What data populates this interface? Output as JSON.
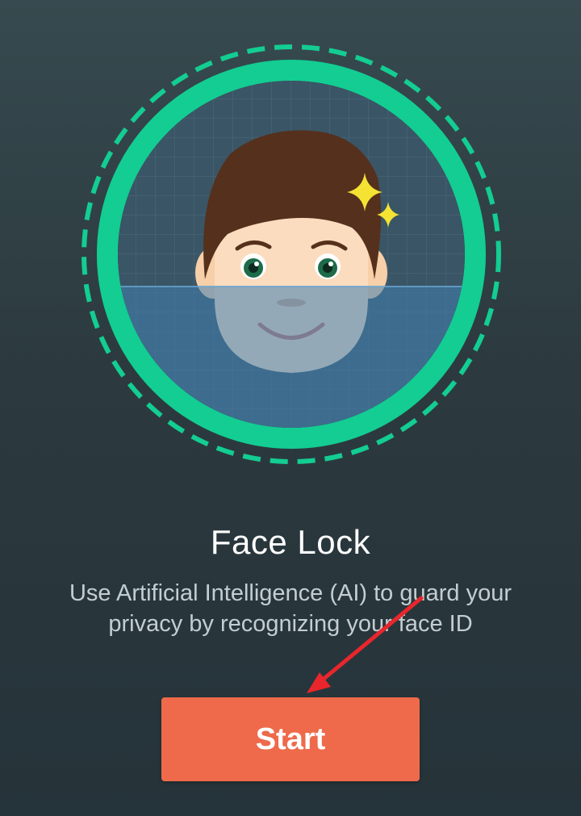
{
  "colors": {
    "background_top": "#364a4f",
    "background_bottom": "#25333a",
    "ring": "#13cd92",
    "face_panel": "#3a5565",
    "scan_band": "#3f7fb0",
    "hair": "#55301c",
    "skin": "#fbdcbf",
    "sparkle": "#f5e334",
    "button": "#ee6a4a",
    "arrow": "#e8262c"
  },
  "illustration": {
    "icon": "face-scan-icon"
  },
  "title": "Face Lock",
  "description": {
    "line1": "Use Artificial Intelligence (AI) to guard your",
    "line2": "privacy by recognizing your face ID"
  },
  "start_button": {
    "label": "Start"
  }
}
